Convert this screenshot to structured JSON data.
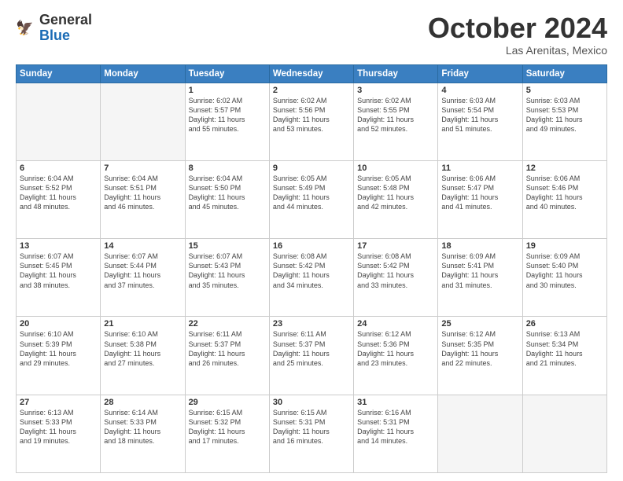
{
  "header": {
    "logo_general": "General",
    "logo_blue": "Blue",
    "month": "October 2024",
    "location": "Las Arenitas, Mexico"
  },
  "days_of_week": [
    "Sunday",
    "Monday",
    "Tuesday",
    "Wednesday",
    "Thursday",
    "Friday",
    "Saturday"
  ],
  "weeks": [
    [
      {
        "num": "",
        "info": ""
      },
      {
        "num": "",
        "info": ""
      },
      {
        "num": "1",
        "info": "Sunrise: 6:02 AM\nSunset: 5:57 PM\nDaylight: 11 hours\nand 55 minutes."
      },
      {
        "num": "2",
        "info": "Sunrise: 6:02 AM\nSunset: 5:56 PM\nDaylight: 11 hours\nand 53 minutes."
      },
      {
        "num": "3",
        "info": "Sunrise: 6:02 AM\nSunset: 5:55 PM\nDaylight: 11 hours\nand 52 minutes."
      },
      {
        "num": "4",
        "info": "Sunrise: 6:03 AM\nSunset: 5:54 PM\nDaylight: 11 hours\nand 51 minutes."
      },
      {
        "num": "5",
        "info": "Sunrise: 6:03 AM\nSunset: 5:53 PM\nDaylight: 11 hours\nand 49 minutes."
      }
    ],
    [
      {
        "num": "6",
        "info": "Sunrise: 6:04 AM\nSunset: 5:52 PM\nDaylight: 11 hours\nand 48 minutes."
      },
      {
        "num": "7",
        "info": "Sunrise: 6:04 AM\nSunset: 5:51 PM\nDaylight: 11 hours\nand 46 minutes."
      },
      {
        "num": "8",
        "info": "Sunrise: 6:04 AM\nSunset: 5:50 PM\nDaylight: 11 hours\nand 45 minutes."
      },
      {
        "num": "9",
        "info": "Sunrise: 6:05 AM\nSunset: 5:49 PM\nDaylight: 11 hours\nand 44 minutes."
      },
      {
        "num": "10",
        "info": "Sunrise: 6:05 AM\nSunset: 5:48 PM\nDaylight: 11 hours\nand 42 minutes."
      },
      {
        "num": "11",
        "info": "Sunrise: 6:06 AM\nSunset: 5:47 PM\nDaylight: 11 hours\nand 41 minutes."
      },
      {
        "num": "12",
        "info": "Sunrise: 6:06 AM\nSunset: 5:46 PM\nDaylight: 11 hours\nand 40 minutes."
      }
    ],
    [
      {
        "num": "13",
        "info": "Sunrise: 6:07 AM\nSunset: 5:45 PM\nDaylight: 11 hours\nand 38 minutes."
      },
      {
        "num": "14",
        "info": "Sunrise: 6:07 AM\nSunset: 5:44 PM\nDaylight: 11 hours\nand 37 minutes."
      },
      {
        "num": "15",
        "info": "Sunrise: 6:07 AM\nSunset: 5:43 PM\nDaylight: 11 hours\nand 35 minutes."
      },
      {
        "num": "16",
        "info": "Sunrise: 6:08 AM\nSunset: 5:42 PM\nDaylight: 11 hours\nand 34 minutes."
      },
      {
        "num": "17",
        "info": "Sunrise: 6:08 AM\nSunset: 5:42 PM\nDaylight: 11 hours\nand 33 minutes."
      },
      {
        "num": "18",
        "info": "Sunrise: 6:09 AM\nSunset: 5:41 PM\nDaylight: 11 hours\nand 31 minutes."
      },
      {
        "num": "19",
        "info": "Sunrise: 6:09 AM\nSunset: 5:40 PM\nDaylight: 11 hours\nand 30 minutes."
      }
    ],
    [
      {
        "num": "20",
        "info": "Sunrise: 6:10 AM\nSunset: 5:39 PM\nDaylight: 11 hours\nand 29 minutes."
      },
      {
        "num": "21",
        "info": "Sunrise: 6:10 AM\nSunset: 5:38 PM\nDaylight: 11 hours\nand 27 minutes."
      },
      {
        "num": "22",
        "info": "Sunrise: 6:11 AM\nSunset: 5:37 PM\nDaylight: 11 hours\nand 26 minutes."
      },
      {
        "num": "23",
        "info": "Sunrise: 6:11 AM\nSunset: 5:37 PM\nDaylight: 11 hours\nand 25 minutes."
      },
      {
        "num": "24",
        "info": "Sunrise: 6:12 AM\nSunset: 5:36 PM\nDaylight: 11 hours\nand 23 minutes."
      },
      {
        "num": "25",
        "info": "Sunrise: 6:12 AM\nSunset: 5:35 PM\nDaylight: 11 hours\nand 22 minutes."
      },
      {
        "num": "26",
        "info": "Sunrise: 6:13 AM\nSunset: 5:34 PM\nDaylight: 11 hours\nand 21 minutes."
      }
    ],
    [
      {
        "num": "27",
        "info": "Sunrise: 6:13 AM\nSunset: 5:33 PM\nDaylight: 11 hours\nand 19 minutes."
      },
      {
        "num": "28",
        "info": "Sunrise: 6:14 AM\nSunset: 5:33 PM\nDaylight: 11 hours\nand 18 minutes."
      },
      {
        "num": "29",
        "info": "Sunrise: 6:15 AM\nSunset: 5:32 PM\nDaylight: 11 hours\nand 17 minutes."
      },
      {
        "num": "30",
        "info": "Sunrise: 6:15 AM\nSunset: 5:31 PM\nDaylight: 11 hours\nand 16 minutes."
      },
      {
        "num": "31",
        "info": "Sunrise: 6:16 AM\nSunset: 5:31 PM\nDaylight: 11 hours\nand 14 minutes."
      },
      {
        "num": "",
        "info": ""
      },
      {
        "num": "",
        "info": ""
      }
    ]
  ]
}
